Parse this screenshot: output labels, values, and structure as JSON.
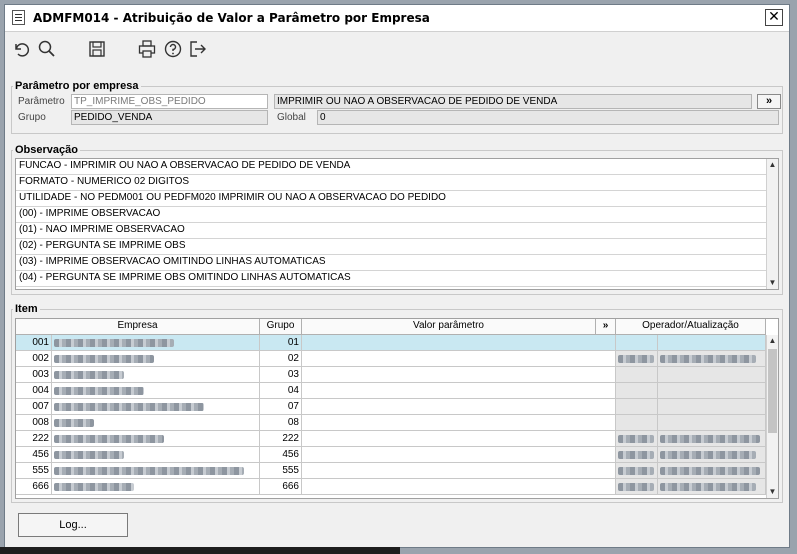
{
  "window": {
    "title": "ADMFM014 - Atribuição de Valor a Parâmetro por Empresa",
    "close": "✕"
  },
  "toolbar": [
    "undo-icon",
    "search-icon",
    "save-icon",
    "print-icon",
    "help-icon",
    "exit-icon"
  ],
  "param_section": {
    "legend": "Parâmetro por empresa",
    "parametro_label": "Parâmetro",
    "parametro_value": "TP_IMPRIME_OBS_PEDIDO",
    "parametro_desc": "IMPRIMIR OU NAO A OBSERVACAO DE PEDIDO DE VENDA",
    "expand": "»",
    "grupo_label": "Grupo",
    "grupo_value": "PEDIDO_VENDA",
    "global_label": "Global",
    "global_value": "0"
  },
  "obs_section": {
    "legend": "Observação",
    "lines": [
      "FUNCAO - IMPRIMIR OU NAO A OBSERVACAO DE PEDIDO DE VENDA",
      "FORMATO - NUMERICO 02 DIGITOS",
      "UTILIDADE - NO PEDM001 OU PEDFM020 IMPRIMIR OU NAO A OBSERVACAO DO PEDIDO",
      "(00) - IMPRIME OBSERVACAO",
      "(01) - NAO IMPRIME OBSERVACAO",
      "(02) - PERGUNTA SE IMPRIME OBS",
      "(03) - IMPRIME OBSERVACAO OMITINDO LINHAS AUTOMATICAS",
      "(04) - PERGUNTA SE IMPRIME OBS OMITINDO LINHAS AUTOMATICAS"
    ]
  },
  "item_section": {
    "legend": "Item",
    "headers": {
      "empresa": "Empresa",
      "grupo": "Grupo",
      "valor": "Valor parâmetro",
      "expand": "»",
      "operador": "Operador/Atualização"
    },
    "rows": [
      {
        "code": "001",
        "grupo": "01",
        "valor": ""
      },
      {
        "code": "002",
        "grupo": "02",
        "valor": ""
      },
      {
        "code": "003",
        "grupo": "03",
        "valor": ""
      },
      {
        "code": "004",
        "grupo": "04",
        "valor": ""
      },
      {
        "code": "007",
        "grupo": "07",
        "valor": ""
      },
      {
        "code": "008",
        "grupo": "08",
        "valor": ""
      },
      {
        "code": "222",
        "grupo": "222",
        "valor": ""
      },
      {
        "code": "456",
        "grupo": "456",
        "valor": ""
      },
      {
        "code": "555",
        "grupo": "555",
        "valor": ""
      },
      {
        "code": "666",
        "grupo": "666",
        "valor": ""
      }
    ]
  },
  "footer": {
    "log_button": "Log..."
  }
}
